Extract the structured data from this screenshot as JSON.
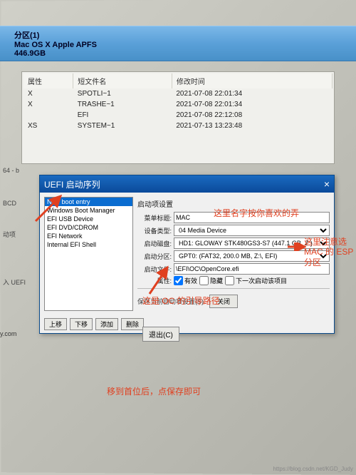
{
  "partition": {
    "title": "分区(1)",
    "line1": "Mac OS X Apple APFS",
    "line2": "446.9GB"
  },
  "file_table": {
    "headers": {
      "attr": "属性",
      "shortname": "短文件名",
      "modtime": "修改时间"
    },
    "rows": [
      {
        "attr": "X",
        "name": "SPOTLI~1",
        "time": "2021-07-08 22:01:34"
      },
      {
        "attr": "X",
        "name": "TRASHE~1",
        "time": "2021-07-08 22:01:34"
      },
      {
        "attr": "",
        "name": "EFI",
        "time": "2021-07-08 22:12:08"
      },
      {
        "attr": "XS",
        "name": "SYSTEM~1",
        "time": "2021-07-13 13:23:48"
      }
    ]
  },
  "left_strip": {
    "l1": "64 - b",
    "l2": "BCD",
    "l3": "动项",
    "l4": "入 UEFI"
  },
  "uefi": {
    "title": "UEFI 启动序列",
    "list": [
      "New boot entry",
      "Windows Boot Manager",
      "EFI USB Device",
      "EFI DVD/CDROM",
      "EFI Network",
      "Internal EFI Shell"
    ],
    "group_title": "启动项设置",
    "labels": {
      "menu_title": "菜单标题:",
      "device_type": "设备类型:",
      "boot_disk": "启动磁盘:",
      "boot_part": "启动分区:",
      "boot_file": "启动文件:",
      "attrs": "属性:"
    },
    "values": {
      "menu_title": "MAC",
      "device_type": "04 Media Device",
      "boot_disk": "HD1: GLOWAY STK480GS3-S7 (447.1 GB, Z:)",
      "boot_part": "GPT0: (FAT32, 200.0 MB, Z:\\, EFI)",
      "boot_file": "\\EFI\\OC\\OpenCore.efi"
    },
    "checkboxes": {
      "valid": "有效",
      "hidden": "隐藏",
      "next_once": "下一次启动该项目"
    },
    "btns": {
      "up": "上移",
      "down": "下移",
      "add": "添加",
      "del": "删除"
    },
    "save_note": "保存当前自动项设置(S)",
    "close": "关闭"
  },
  "exit": "退出(C)",
  "annotations": {
    "name_hint": "这里名字按你喜欢的弄",
    "esp_hint": "这里注意选\nMAC 的 ESP\n分区",
    "oc_path": "这是 OC 的引导路径",
    "save_hint": "移到首位后，点保存即可"
  },
  "watermark": "https://blog.csdn.net/KGD_Judy",
  "ycom": "y.com"
}
